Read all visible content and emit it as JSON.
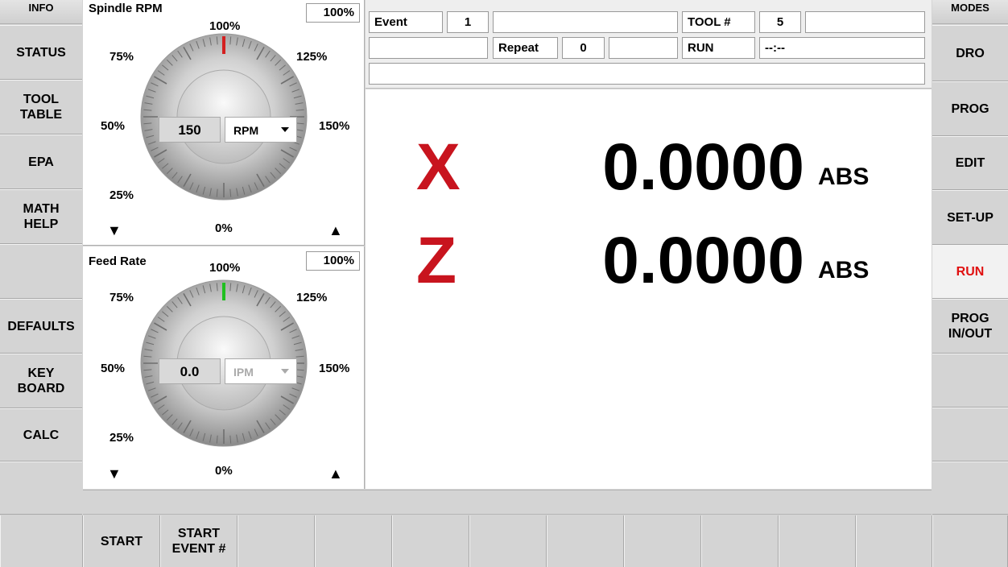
{
  "left_panel": {
    "header": "INFO",
    "buttons": [
      "STATUS",
      "TOOL\nTABLE",
      "EPA",
      "MATH\nHELP",
      "",
      "DEFAULTS",
      "KEY\nBOARD",
      "CALC",
      ""
    ]
  },
  "right_panel": {
    "header": "MODES",
    "buttons": [
      "DRO",
      "PROG",
      "EDIT",
      "SET-UP",
      "RUN",
      "PROG\nIN/OUT",
      "",
      "",
      ""
    ],
    "active": "RUN"
  },
  "spindle": {
    "title": "Spindle RPM",
    "override": "100%",
    "labels": {
      "p0": "0%",
      "p25": "25%",
      "p50": "50%",
      "p75": "75%",
      "p100": "100%",
      "p125": "125%",
      "p150": "150%"
    },
    "value": "150",
    "unit": "RPM",
    "down_arrow": "▼",
    "up_arrow": "▲",
    "indicator_color": "#d42020"
  },
  "feed": {
    "title": "Feed Rate",
    "override": "100%",
    "labels": {
      "p0": "0%",
      "p25": "25%",
      "p50": "50%",
      "p75": "75%",
      "p100": "100%",
      "p125": "125%",
      "p150": "150%"
    },
    "value": "0.0",
    "unit": "IPM",
    "down_arrow": "▼",
    "up_arrow": "▲",
    "indicator_color": "#20c020"
  },
  "info": {
    "event_label": "Event",
    "event_value": "1",
    "event_desc": "",
    "tool_label": "TOOL #",
    "tool_value": "5",
    "tool_desc": "",
    "row2_blank": "",
    "repeat_label": "Repeat",
    "repeat_value": "0",
    "repeat_extra": "",
    "run_label": "RUN",
    "run_time": "--:--",
    "message": ""
  },
  "dro": {
    "axes": [
      {
        "name": "X",
        "value": "0.0000",
        "mode": "ABS"
      },
      {
        "name": "Z",
        "value": "0.0000",
        "mode": "ABS"
      }
    ]
  },
  "status_strip": "",
  "bottom_buttons": [
    "",
    "START",
    "START\nEVENT #",
    "",
    "",
    "",
    "",
    "",
    "",
    "",
    "",
    "",
    ""
  ],
  "colors": {
    "axis_letter": "#c8141e",
    "active_mode": "#e01010"
  }
}
